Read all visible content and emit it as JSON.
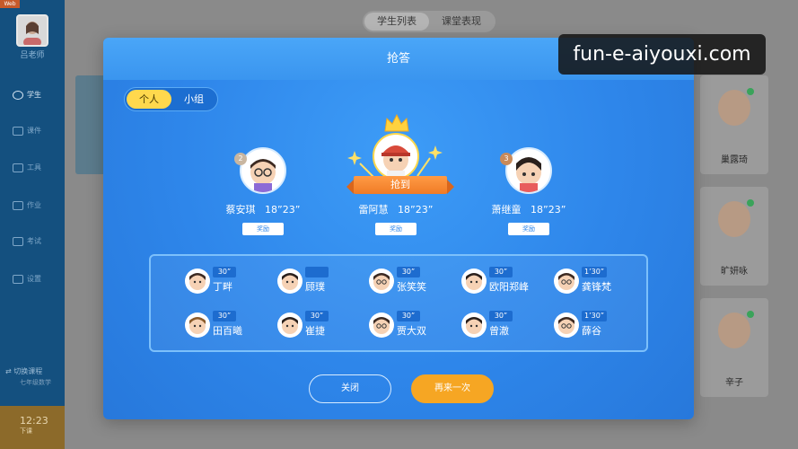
{
  "app": {
    "badge": "Web"
  },
  "sidebar": {
    "teacher_name": "吕老师",
    "items": [
      {
        "label": "学生",
        "icon": "students-icon",
        "active": true
      },
      {
        "label": "课件",
        "icon": "courseware-icon"
      },
      {
        "label": "工具",
        "icon": "tools-icon"
      },
      {
        "label": "作业",
        "icon": "homework-icon"
      },
      {
        "label": "考试",
        "icon": "exam-icon"
      },
      {
        "label": "设置",
        "icon": "settings-icon"
      }
    ],
    "switch_course": "切换课程",
    "switch_course_sub": "七年级数学",
    "clock": "12:23",
    "clock_sub": "下课"
  },
  "header_tabs": [
    "学生列表",
    "课堂表现"
  ],
  "background_students": [
    "巢露琦",
    "旷妍咏",
    "辛子"
  ],
  "modal": {
    "title": "抢答",
    "toggle": [
      "个人",
      "小组"
    ],
    "banner": "抢到",
    "reward_label": "奖励",
    "podium": [
      {
        "rank": "1",
        "name": "雷阿慧",
        "time": "18”23”"
      },
      {
        "rank": "2",
        "name": "蔡安琪",
        "time": "18”23”"
      },
      {
        "rank": "3",
        "name": "萧继童",
        "time": "18”23”"
      }
    ],
    "others": [
      {
        "name": "丁畔",
        "time": "30”"
      },
      {
        "name": "顾璞",
        "time": ""
      },
      {
        "name": "张笑笑",
        "time": "30”"
      },
      {
        "name": "欧阳郑峰",
        "time": "30”"
      },
      {
        "name": "龚锋梵",
        "time": "1’30”"
      },
      {
        "name": "田百曦",
        "time": "30”"
      },
      {
        "name": "崔捷",
        "time": "30”"
      },
      {
        "name": "贾大双",
        "time": "30”"
      },
      {
        "name": "曾澈",
        "time": "30”"
      },
      {
        "name": "薛谷",
        "time": "1’30”"
      }
    ],
    "close_label": "关闭",
    "again_label": "再来一次"
  },
  "watermark": "fun-e-aiyouxi.com",
  "colors": {
    "modal_blue": "#2e86ea",
    "accent_yellow": "#ffd84d",
    "accent_orange": "#f6a623"
  }
}
